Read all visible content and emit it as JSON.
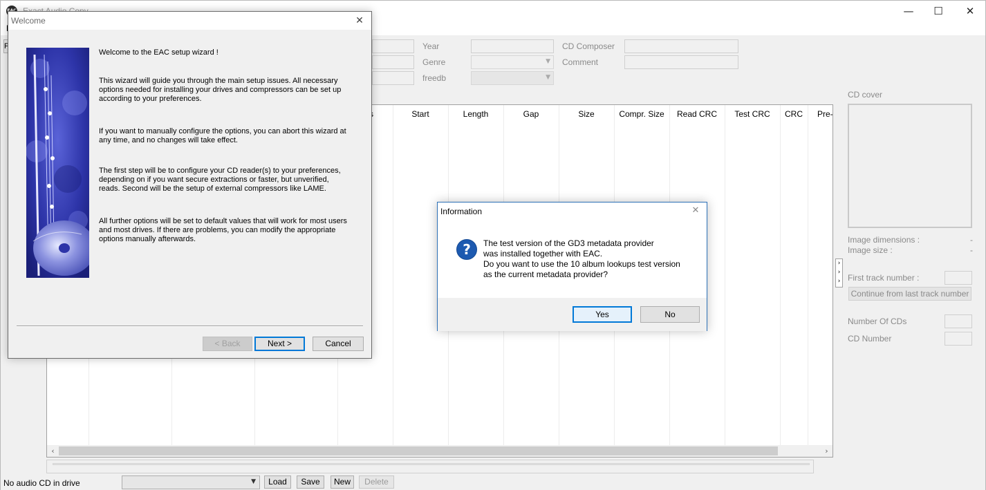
{
  "app": {
    "title": "Exact Audio Copy",
    "icon_text": "EAC"
  },
  "window_controls": {
    "minimize": "—",
    "maximize": "☐",
    "close": "✕"
  },
  "menu": {
    "first_item": "E"
  },
  "left_strip": {
    "label": "P"
  },
  "metadata": {
    "year_label": "Year",
    "cd_composer_label": "CD Composer",
    "genre_label": "Genre",
    "comment_label": "Comment",
    "freedb_label": "freedb"
  },
  "tracklist": {
    "columns": [
      "s",
      "Start",
      "Length",
      "Gap",
      "Size",
      "Compr. Size",
      "Read CRC",
      "Test CRC",
      "CRC",
      "Pre-"
    ]
  },
  "side_panel": {
    "cd_cover_label": "CD cover",
    "image_dimensions_label": "Image dimensions :",
    "image_dimensions_value": "-",
    "image_size_label": "Image size :",
    "image_size_value": "-",
    "first_track_label": "First track number :",
    "continue_button": "Continue from last track number",
    "number_of_cds_label": "Number Of CDs",
    "cd_number_label": "CD Number",
    "toggle_glyphs": "›\n›\n›"
  },
  "statusbar": {
    "status": "No audio CD in drive",
    "load": "Load",
    "save": "Save",
    "new": "New",
    "delete": "Delete"
  },
  "wizard": {
    "title": "Welcome",
    "close": "✕",
    "heading": "Welcome to the EAC setup wizard !",
    "p1": "This wizard will guide you through the main setup issues. All necessary options needed for installing your drives and compressors can be set up according to your preferences.",
    "p2": "If you want to manually configure the options, you can abort this wizard at any time, and no changes will take effect.",
    "p3": "The first step will be to configure your CD reader(s) to your preferences, depending on if you want secure extractions or faster, but unverified, reads. Second will be the setup of external compressors like LAME.",
    "p4": "All further options will be set to default values that will work for most users and most drives. If there are problems, you can modify the appropriate options manually afterwards.",
    "back": "< Back",
    "next": "Next >",
    "cancel": "Cancel"
  },
  "info_dialog": {
    "title": "Information",
    "close": "✕",
    "icon": "?",
    "line1": "The test version of the GD3 metadata provider",
    "line2": "was installed together with EAC.",
    "line3": "Do you want to use the 10 album lookups test version",
    "line4": "as the current metadata provider?",
    "yes": "Yes",
    "no": "No"
  },
  "colors": {
    "accent": "#0078d7",
    "dialog_border": "#2b6fb6",
    "question_icon": "#1d5ab0",
    "wizard_art": "#2a2f9c"
  }
}
